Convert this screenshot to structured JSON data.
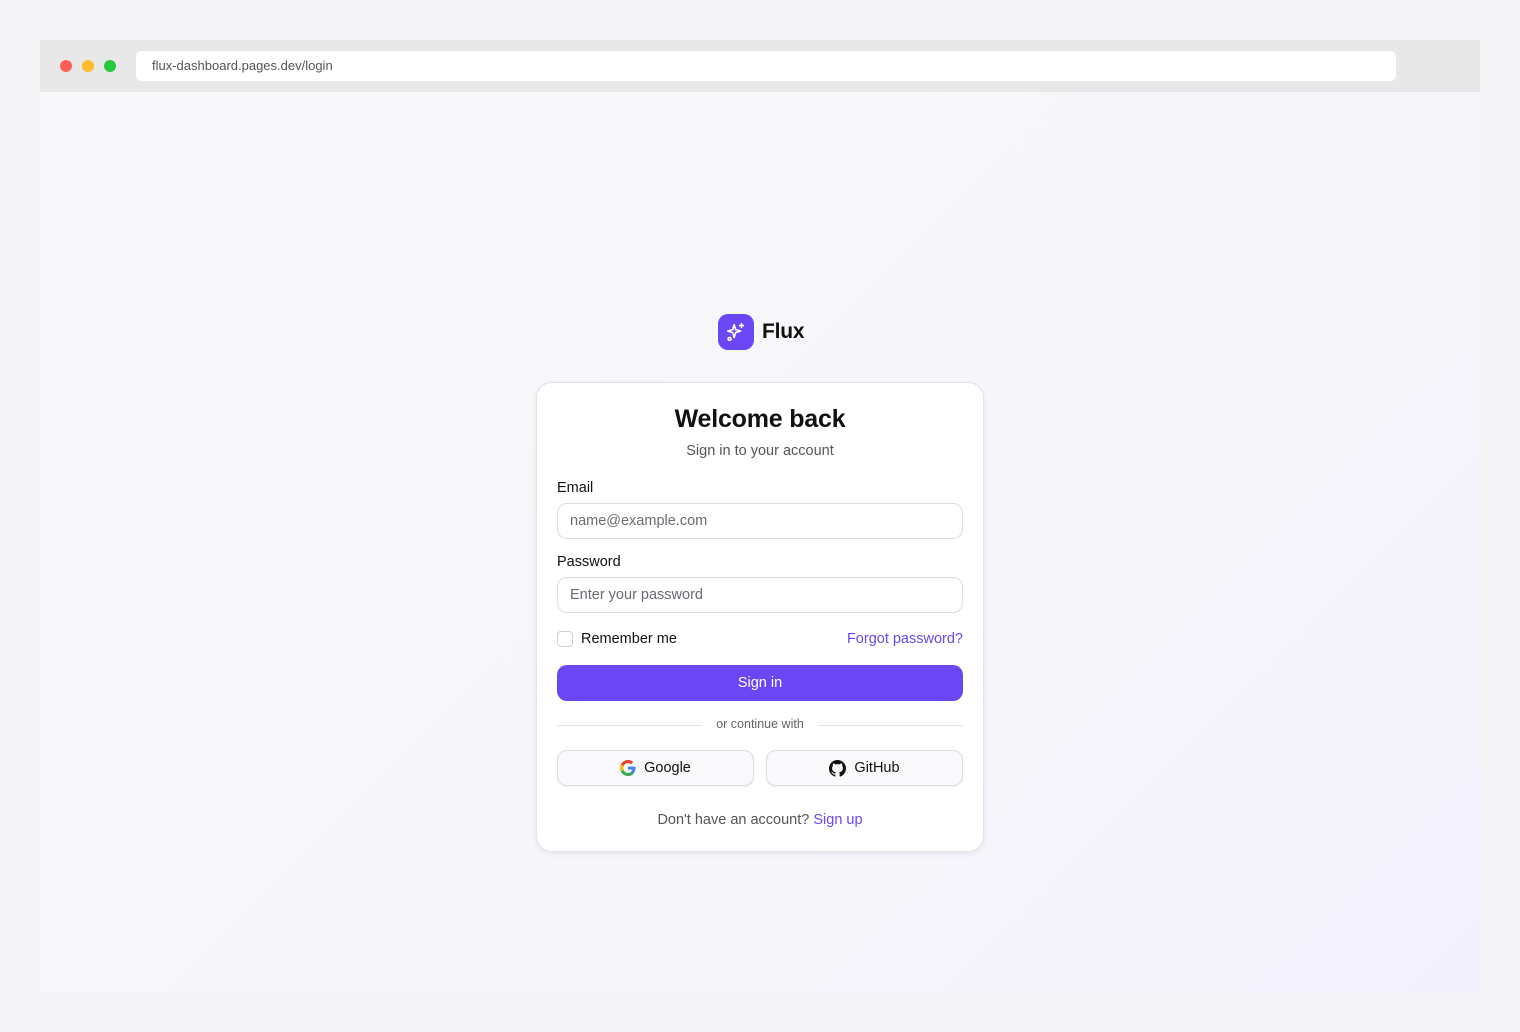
{
  "browser": {
    "url": "flux-dashboard.pages.dev/login"
  },
  "brand": {
    "name": "Flux",
    "logo_icon": "sparkles-icon",
    "accent_color": "#6b46f5"
  },
  "card": {
    "title": "Welcome back",
    "subtitle": "Sign in to your account",
    "email": {
      "label": "Email",
      "placeholder": "name@example.com",
      "value": ""
    },
    "password": {
      "label": "Password",
      "placeholder": "Enter your password",
      "value": ""
    },
    "remember_me": {
      "label": "Remember me",
      "checked": false
    },
    "forgot_password_label": "Forgot password?",
    "sign_in_label": "Sign in",
    "divider_text": "or continue with",
    "social": [
      {
        "label": "Google",
        "icon": "google-icon"
      },
      {
        "label": "GitHub",
        "icon": "github-icon"
      }
    ],
    "signup_prompt": "Don't have an account?",
    "signup_label": "Sign up"
  }
}
